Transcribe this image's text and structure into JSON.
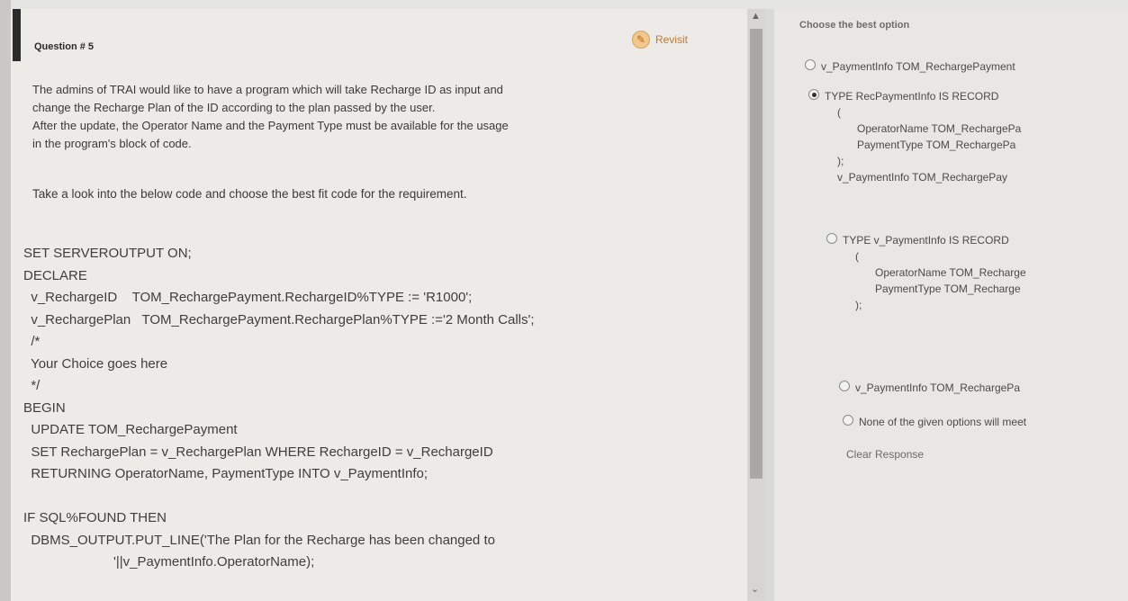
{
  "question": {
    "number": "Question # 5",
    "revisit_label": "Revisit",
    "text_lines": [
      "The admins of TRAI would like to have a program which will take Recharge ID as input and",
      "change the Recharge Plan of the ID according to the plan passed by the user.",
      "After the update, the Operator Name and the Payment Type must be available for the usage",
      "in the program's block of code."
    ],
    "hint": "Take a look into the below code and choose the best fit code for the requirement.",
    "code_lines": [
      "SET SERVEROUTPUT ON;",
      "DECLARE",
      "  v_RechargeID    TOM_RechargePayment.RechargeID%TYPE := 'R1000';",
      "  v_RechargePlan   TOM_RechargePayment.RechargePlan%TYPE :='2 Month Calls';",
      "  /*",
      "  Your Choice goes here",
      "  */",
      "BEGIN",
      "  UPDATE TOM_RechargePayment",
      "  SET RechargePlan = v_RechargePlan WHERE RechargeID = v_RechargeID",
      "  RETURNING OperatorName, PaymentType INTO v_PaymentInfo;",
      "",
      "IF SQL%FOUND THEN",
      "  DBMS_OUTPUT.PUT_LINE('The Plan for the Recharge has been changed to",
      "                        '||v_PaymentInfo.OperatorName);"
    ]
  },
  "options_panel": {
    "header": "Choose the best option",
    "options": [
      {
        "lines": [
          "v_PaymentInfo   TOM_RechargePayment"
        ],
        "selected": false
      },
      {
        "lines": [
          "TYPE RecPaymentInfo IS RECORD",
          "(",
          "OperatorName   TOM_RechargePa",
          "PaymentType    TOM_RechargePa",
          ");",
          "v_PaymentInfo   TOM_RechargePay"
        ],
        "selected": true
      },
      {
        "lines": [
          "TYPE v_PaymentInfo IS RECORD",
          "(",
          "OperatorName   TOM_Recharge",
          "PaymentType    TOM_Recharge",
          ");"
        ],
        "selected": false
      },
      {
        "lines": [
          "v_PaymentInfo   TOM_RechargePa"
        ],
        "selected": false
      },
      {
        "lines": [
          "None of the given options will meet"
        ],
        "selected": false
      }
    ],
    "clear_label": "Clear Response"
  },
  "colors": {
    "revisit": "#c07a33",
    "panel_bg": "#ecebe8",
    "text": "#3a3a3a"
  },
  "icons": {
    "revisit": "pencil-circle-icon",
    "scroll_up": "chevron-up-icon",
    "scroll_down": "chevron-down-icon"
  }
}
